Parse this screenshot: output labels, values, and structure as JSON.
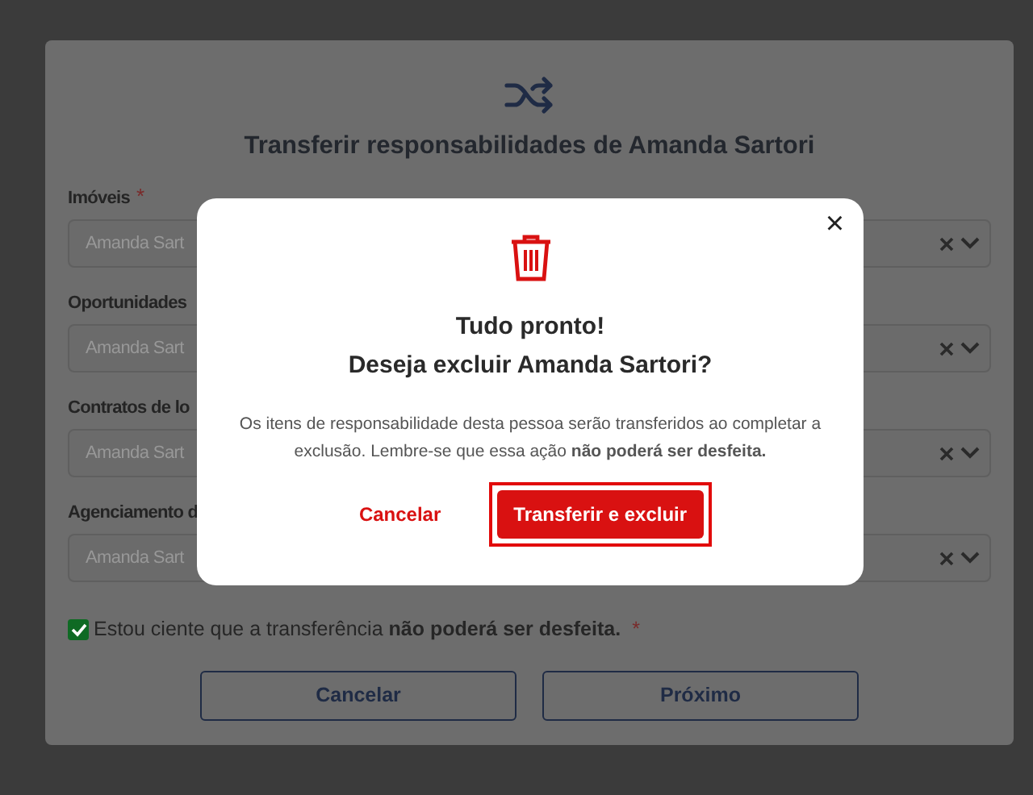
{
  "transfer_dialog": {
    "title": "Transferir responsabilidades de Amanda Sartori",
    "fields": [
      {
        "label": "Imóveis",
        "required_mark": "*",
        "value": "Amanda Sart"
      },
      {
        "label": "Oportunidades",
        "value": "Amanda Sart"
      },
      {
        "label": "Contratos de lo",
        "value": "Amanda Sart"
      },
      {
        "label": "Agenciamento d",
        "value": "Amanda Sart"
      }
    ],
    "acknowledge": {
      "text": "Estou ciente que a transferência **não poderá ser desfeita.**",
      "checked": true,
      "required_mark": "*"
    },
    "buttons": [
      "Cancelar",
      "Próximo"
    ]
  },
  "confirm_dialog": {
    "close": "×",
    "heading": [
      "Tudo pronto!",
      "Deseja excluir Amanda Sartori?"
    ],
    "message": "Os itens de responsabilidade desta pessoa serão transferidos ao completar a exclusão. Lembre-se que essa ação **não poderá ser desfeita.**",
    "cancel": "Cancelar",
    "confirm": {
      "label": "Transferir e excluir",
      "focused": true
    }
  }
}
